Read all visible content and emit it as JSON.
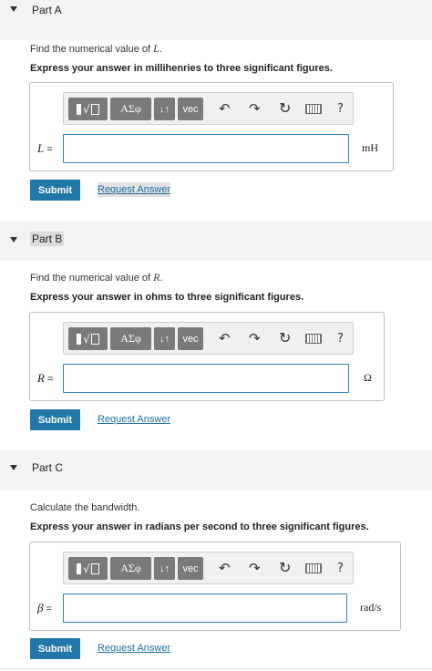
{
  "parts": [
    {
      "title": "Part A",
      "prompt_text": "Find the numerical value of ",
      "prompt_var": "L",
      "prompt_end": ".",
      "instruction": "Express your answer in millihenries to three significant figures.",
      "var_label": "L",
      "input_value": "",
      "unit": "mH",
      "submit_label": "Submit",
      "request_label": "Request Answer"
    },
    {
      "title": "Part B",
      "prompt_text": "Find the numerical value of ",
      "prompt_var": "R",
      "prompt_end": ".",
      "instruction": "Express your answer in ohms to three significant figures.",
      "var_label": "R",
      "input_value": "",
      "unit": "Ω",
      "submit_label": "Submit",
      "request_label": "Request Answer"
    },
    {
      "title": "Part C",
      "prompt_text": "Calculate the bandwidth.",
      "prompt_var": "",
      "prompt_end": "",
      "instruction": "Express your answer in radians per second to three significant figures.",
      "var_label": "β",
      "input_value": "",
      "unit": "rad/s",
      "submit_label": "Submit",
      "request_label": "Request Answer"
    }
  ],
  "toolbar": {
    "sqrt_symbol": "√",
    "greek_label": "ΑΣφ",
    "arrows_label": "↓↑",
    "vec_label": "vec",
    "undo_glyph": "↶",
    "redo_glyph": "↷",
    "reset_glyph": "↻",
    "help_glyph": "?"
  },
  "equals": " ="
}
